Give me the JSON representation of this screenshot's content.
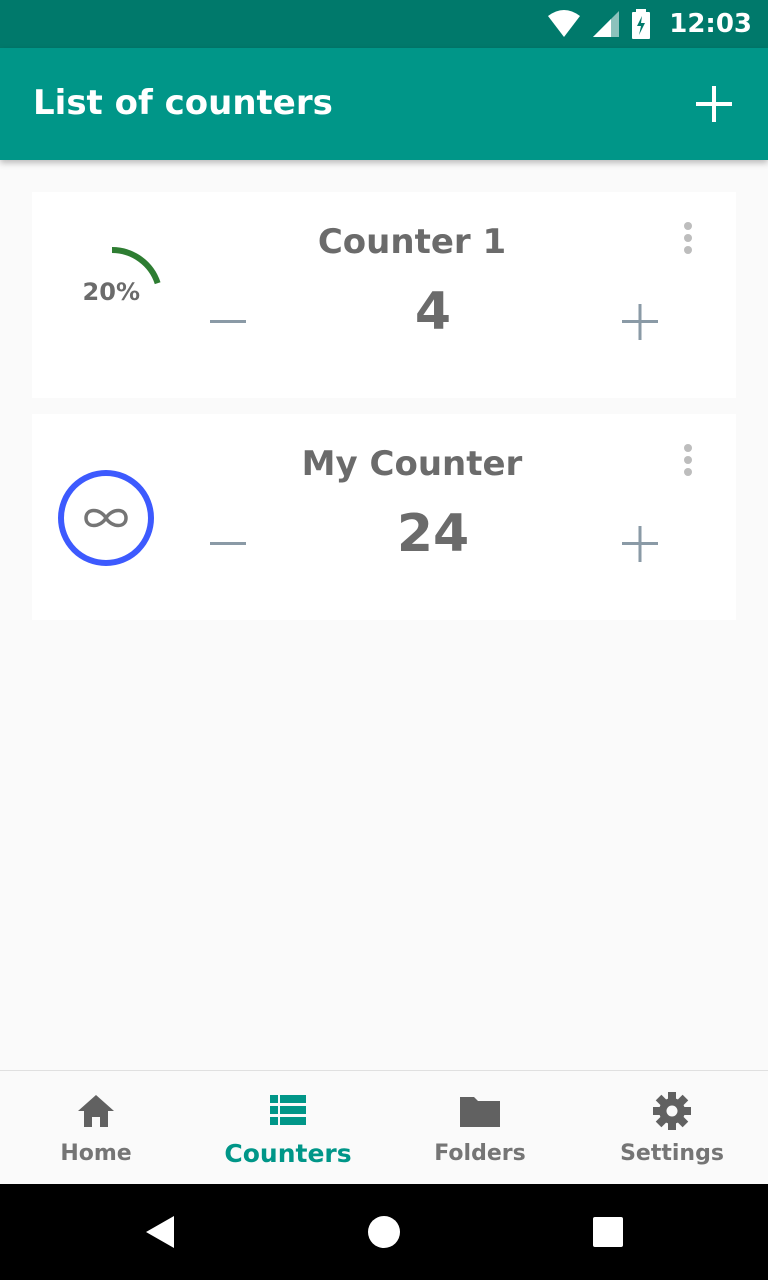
{
  "status_bar": {
    "time": "12:03",
    "icons": [
      "wifi-icon",
      "cell-signal-icon",
      "battery-charging-icon"
    ]
  },
  "app_bar": {
    "title": "List of counters",
    "add_icon": "plus-icon"
  },
  "counters": [
    {
      "name": "Counter 1",
      "value": "4",
      "progress_label": "20%",
      "progress": 0.2,
      "progress_color": "#2e7d32",
      "decrement_icon": "minus-icon",
      "increment_icon": "plus-icon",
      "menu_icon": "more-vert-icon"
    },
    {
      "name": "My Counter",
      "value": "24",
      "goal_icon": "infinity-icon",
      "ring_color": "#3d5afe",
      "decrement_icon": "minus-icon",
      "increment_icon": "plus-icon",
      "menu_icon": "more-vert-icon"
    }
  ],
  "bottom_nav": {
    "items": [
      {
        "label": "Home",
        "icon": "home-icon",
        "active": false
      },
      {
        "label": "Counters",
        "icon": "list-icon",
        "active": true
      },
      {
        "label": "Folders",
        "icon": "folder-icon",
        "active": false
      },
      {
        "label": "Settings",
        "icon": "gear-icon",
        "active": false
      }
    ]
  },
  "system_nav": {
    "buttons": [
      "back-icon",
      "home-circle-icon",
      "recents-icon"
    ]
  },
  "colors": {
    "primary": "#009688",
    "primary_dark": "#00796b",
    "text_secondary": "#6b6b6b"
  }
}
